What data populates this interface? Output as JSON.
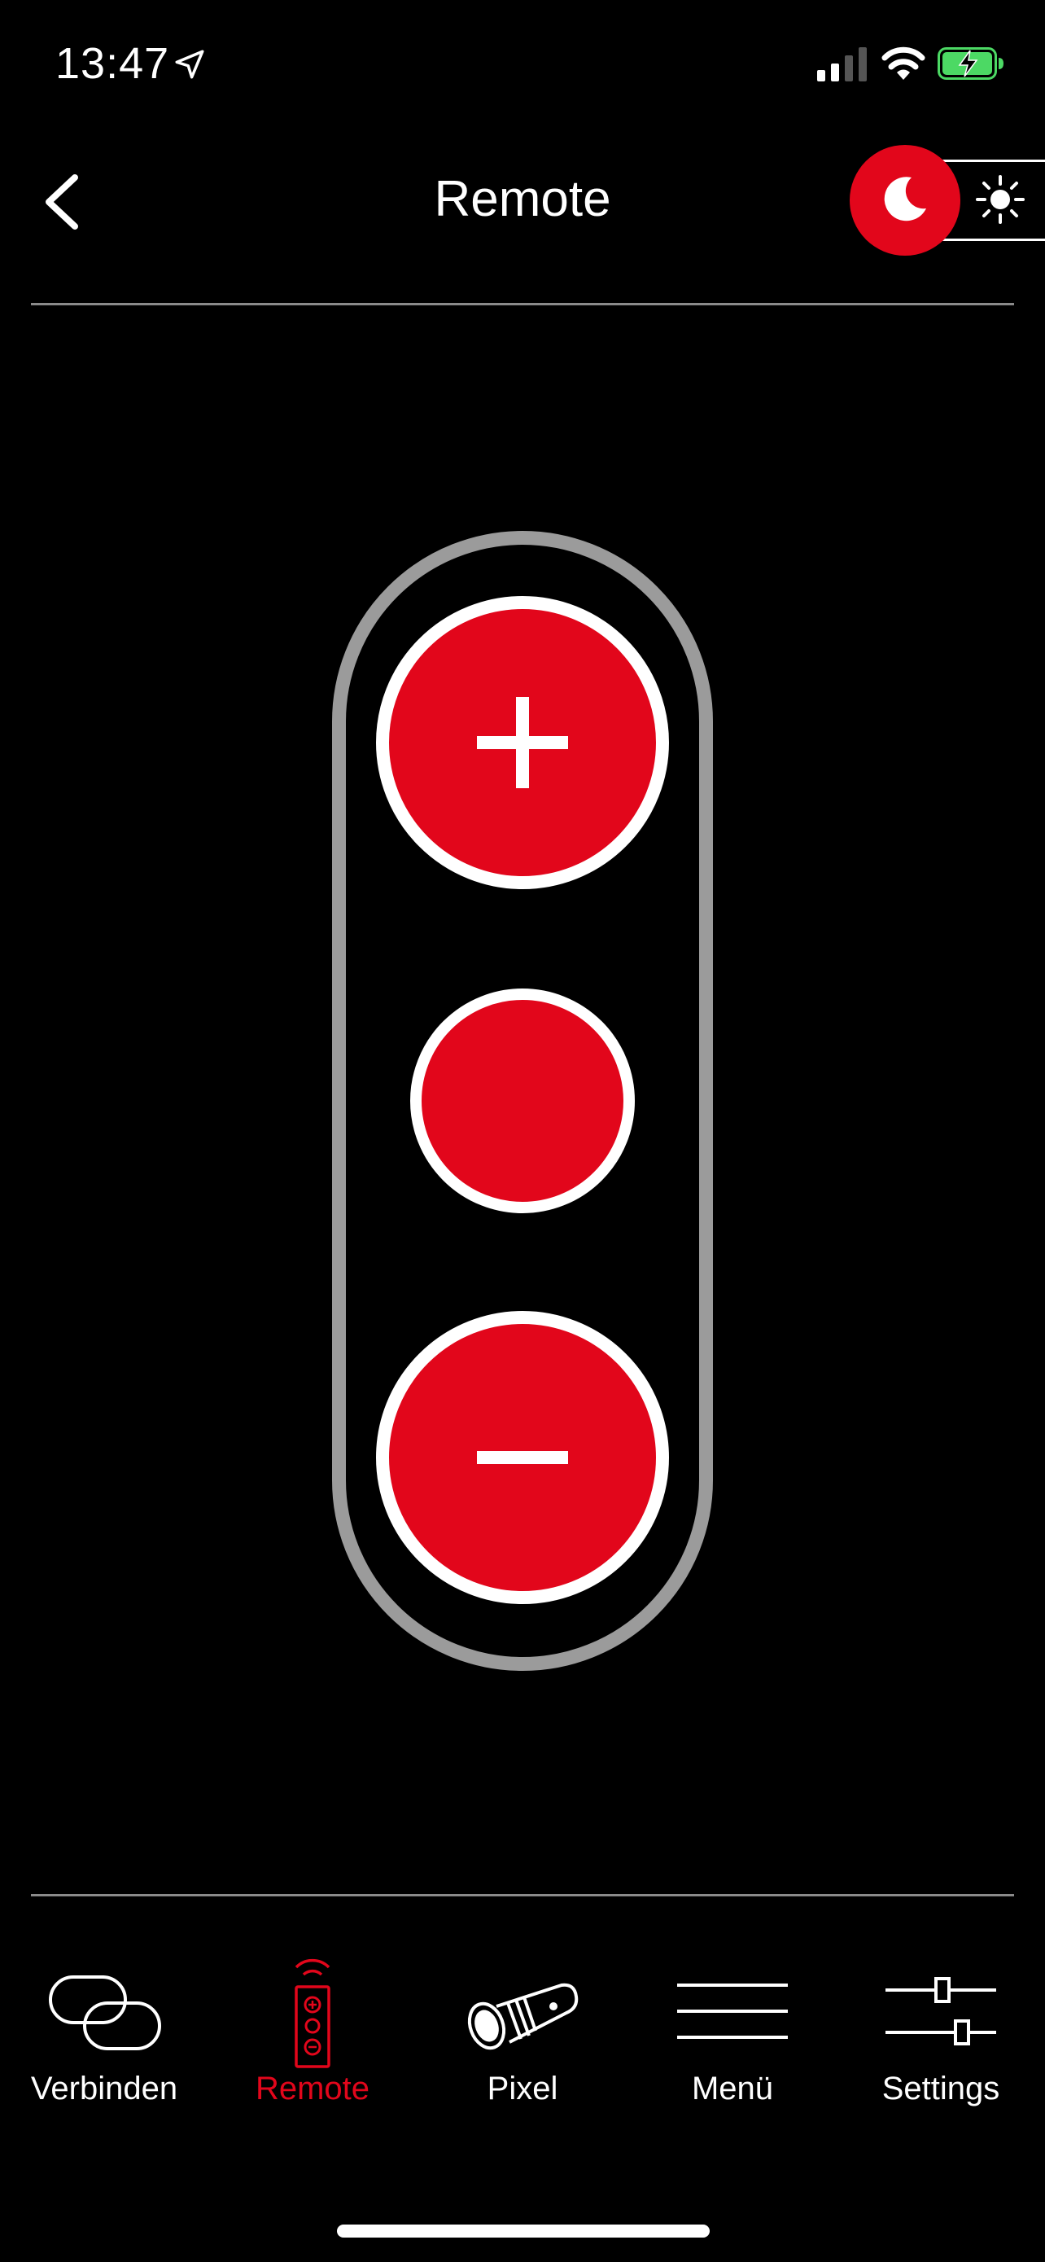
{
  "status_bar": {
    "time": "13:47",
    "icons": [
      "location-arrow-icon",
      "cellular-signal-icon",
      "wifi-icon",
      "battery-charging-icon"
    ]
  },
  "header": {
    "title": "Remote",
    "back_icon": "chevron-left-icon",
    "theme_toggle": {
      "state": "dark",
      "active_icon": "moon-icon",
      "inactive_icon": "sun-icon"
    }
  },
  "remote": {
    "buttons": [
      {
        "name": "plus",
        "icon": "plus-icon"
      },
      {
        "name": "center",
        "icon": "none"
      },
      {
        "name": "minus",
        "icon": "minus-icon"
      }
    ]
  },
  "tabs": [
    {
      "label": "Verbinden",
      "icon": "link-icon",
      "active": false
    },
    {
      "label": "Remote",
      "icon": "remote-control-icon",
      "active": true
    },
    {
      "label": "Pixel",
      "icon": "scope-device-icon",
      "active": false
    },
    {
      "label": "Menü",
      "icon": "menu-lines-icon",
      "active": false
    },
    {
      "label": "Settings",
      "icon": "sliders-icon",
      "active": false
    }
  ],
  "colors": {
    "accent": "#e2061b",
    "background": "#000000",
    "pill_border": "#9b9b9b",
    "divider": "#8a8a8a"
  }
}
